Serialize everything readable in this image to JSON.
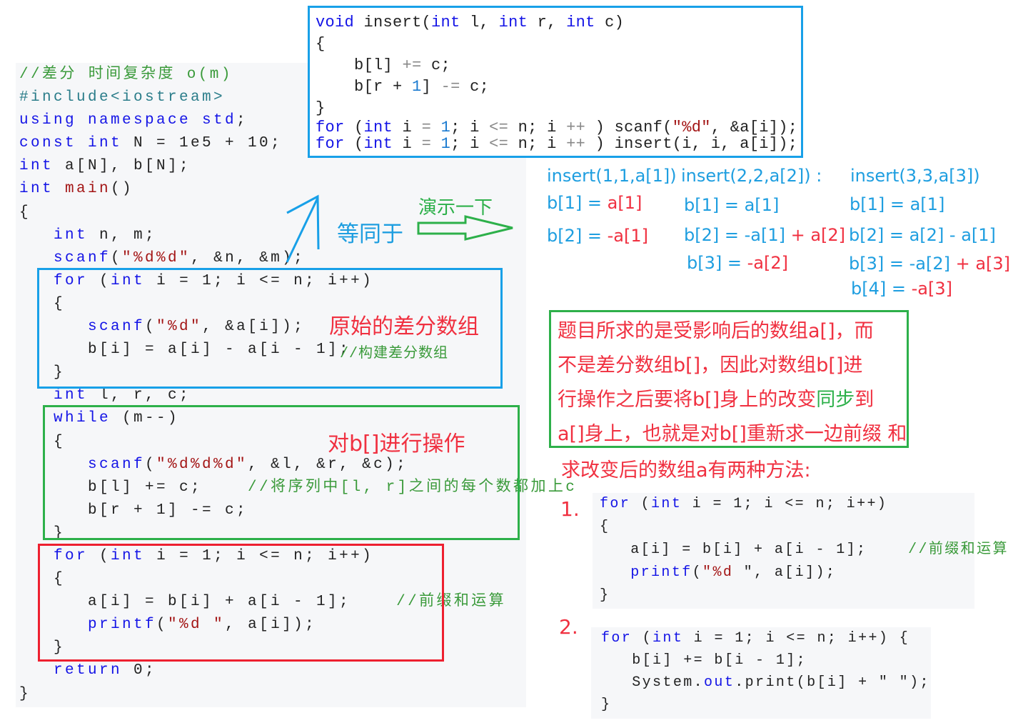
{
  "main_code": {
    "lines": [
      [
        [
          "//差分 时间复杂度 o(m)",
          "cm"
        ]
      ],
      [
        [
          "#include<iostream>",
          "pp"
        ]
      ],
      [
        [
          "using namespace std",
          "k"
        ],
        [
          ";",
          ""
        ]
      ],
      [
        [
          "const int",
          "k"
        ],
        [
          " N = 1e5 + 10;",
          ""
        ]
      ],
      [
        [
          "int",
          "k"
        ],
        [
          " a[N], b[N];",
          ""
        ]
      ],
      [
        [
          "int",
          "k"
        ],
        [
          " ",
          ""
        ],
        [
          "main",
          "f"
        ],
        [
          "()",
          ""
        ]
      ],
      [
        [
          "{",
          ""
        ]
      ],
      [
        [
          "   ",
          ""
        ],
        [
          "int",
          "k"
        ],
        [
          " n, m;",
          ""
        ]
      ],
      [
        [
          "   ",
          ""
        ],
        [
          "scanf",
          "fn"
        ],
        [
          "(",
          ""
        ],
        [
          "\"%d%d\"",
          "s"
        ],
        [
          ", &n, &m);",
          ""
        ]
      ],
      [
        [
          "   ",
          ""
        ],
        [
          "for",
          "k"
        ],
        [
          " (",
          ""
        ],
        [
          "int",
          "k"
        ],
        [
          " i = 1; i <= n; i++)",
          ""
        ]
      ],
      [
        [
          "   {",
          ""
        ]
      ],
      [
        [
          "      ",
          ""
        ],
        [
          "scanf",
          "fn"
        ],
        [
          "(",
          ""
        ],
        [
          "\"%d\"",
          "s"
        ],
        [
          ", &a[i]);",
          ""
        ]
      ],
      [
        [
          "      b[i] = a[i] - a[i - 1];",
          ""
        ]
      ],
      [
        [
          "   }",
          ""
        ]
      ],
      [
        [
          "   ",
          ""
        ],
        [
          "int",
          "k"
        ],
        [
          " l, r, c;",
          ""
        ]
      ],
      [
        [
          "   ",
          ""
        ],
        [
          "while",
          "k"
        ],
        [
          " (m--)",
          ""
        ]
      ],
      [
        [
          "   {",
          ""
        ]
      ],
      [
        [
          "      ",
          ""
        ],
        [
          "scanf",
          "fn"
        ],
        [
          "(",
          ""
        ],
        [
          "\"%d%d%d\"",
          "s"
        ],
        [
          ", &l, &r, &c);",
          ""
        ]
      ],
      [
        [
          "      b[l] += c;    ",
          ""
        ],
        [
          "//将序列中[l, r]之间的每个数都加上c",
          "cm"
        ]
      ],
      [
        [
          "      b[r + 1] -= c;",
          ""
        ]
      ],
      [
        [
          "   }",
          ""
        ]
      ],
      [
        [
          "   ",
          ""
        ],
        [
          "for",
          "k"
        ],
        [
          " (",
          ""
        ],
        [
          "int",
          "k"
        ],
        [
          " i = 1; i <= n; i++)",
          ""
        ]
      ],
      [
        [
          "   {",
          ""
        ]
      ],
      [
        [
          "      a[i] = b[i] + a[i - 1];    ",
          ""
        ],
        [
          "//前缀和运算",
          "cm"
        ]
      ],
      [
        [
          "      ",
          ""
        ],
        [
          "printf",
          "fn"
        ],
        [
          "(",
          ""
        ],
        [
          "\"%d \"",
          "s"
        ],
        [
          ", a[i]);",
          ""
        ]
      ],
      [
        [
          "   }",
          ""
        ]
      ],
      [
        [
          "   ",
          ""
        ],
        [
          "return",
          "k"
        ],
        [
          " 0;",
          ""
        ]
      ],
      [
        [
          "}",
          ""
        ]
      ]
    ]
  },
  "insert_code": {
    "lines": [
      [
        [
          "void",
          "k"
        ],
        [
          " insert(",
          ""
        ],
        [
          "int",
          "k"
        ],
        [
          " l, ",
          ""
        ],
        [
          "int",
          "k"
        ],
        [
          " r, ",
          ""
        ],
        [
          "int",
          "k"
        ],
        [
          " c)",
          ""
        ]
      ],
      [
        [
          "{",
          ""
        ]
      ],
      [
        [
          "    b[l] ",
          ""
        ],
        [
          "+=",
          "op"
        ],
        [
          " c;",
          ""
        ]
      ],
      [
        [
          "    b[r + ",
          ""
        ],
        [
          "1",
          "nm"
        ],
        [
          "] ",
          ""
        ],
        [
          "-=",
          "op"
        ],
        [
          " c;",
          ""
        ]
      ],
      [
        [
          "}",
          ""
        ]
      ],
      [
        [
          "for",
          "k"
        ],
        [
          " (",
          ""
        ],
        [
          "int",
          "k"
        ],
        [
          " i ",
          ""
        ],
        [
          "=",
          "op"
        ],
        [
          " ",
          ""
        ],
        [
          "1",
          "nm"
        ],
        [
          "; i ",
          ""
        ],
        [
          "<=",
          "op"
        ],
        [
          " n; i ",
          ""
        ],
        [
          "++",
          "op"
        ],
        [
          " ) scanf(",
          ""
        ],
        [
          "\"%d\"",
          "s"
        ],
        [
          ", &a[i]);",
          ""
        ]
      ],
      [
        [
          "for",
          "k"
        ],
        [
          " (",
          ""
        ],
        [
          "int",
          "k"
        ],
        [
          " i ",
          ""
        ],
        [
          "=",
          "op"
        ],
        [
          " ",
          ""
        ],
        [
          "1",
          "nm"
        ],
        [
          "; i ",
          ""
        ],
        [
          "<=",
          "op"
        ],
        [
          " n; i ",
          ""
        ],
        [
          "++",
          "op"
        ],
        [
          " ) insert(i, i, a[i]);",
          ""
        ]
      ]
    ]
  },
  "annotations": {
    "equivalent": "等同于",
    "demo": "演示一下",
    "original_diff": "原始的差分数组",
    "build_comment": "//构建差分数组",
    "operate_b": "对b[]进行操作"
  },
  "calc": {
    "col1": {
      "title": "insert(1,1,a[1])",
      "l1a": "b[1] = ",
      "l1b": "a[1]",
      "l2a": "b[2] = ",
      "l2b": "-a[1]"
    },
    "col2": {
      "title": "insert(2,2,a[2]) :",
      "l1": "b[1] = a[1]",
      "l2a": "b[2] = -a[1] ",
      "l2b": "+ a[2]",
      "l3a": "b[3] = ",
      "l3b": "-a[2]"
    },
    "col3": {
      "title": "insert(3,3,a[3])",
      "l1": "b[1] = a[1]",
      "l2": "b[2] = a[2] - a[1]",
      "l3a": "b[3] = -a[2] ",
      "l3b": "+ a[3]",
      "l4a": "b[4] = ",
      "l4b": "-a[3]"
    }
  },
  "explanation": {
    "line1": "题目所求的是受影响后的数组a[]，而",
    "line2": "不是差分数组b[]，因此对数组b[]进",
    "line3a": "行操作之后要将b[]身上的改变",
    "line3b": "同步",
    "line3c": "到",
    "line4": "a[]身上，也就是对b[]重新求一边前缀 和",
    "methods": "求改变后的数组a有两种方法:"
  },
  "method1": {
    "label": "1.",
    "lines": [
      [
        [
          "for",
          "k"
        ],
        [
          " (",
          ""
        ],
        [
          "int",
          "k"
        ],
        [
          " i = 1; i <= n; i++)",
          ""
        ]
      ],
      [
        [
          "{",
          ""
        ]
      ],
      [
        [
          "   a[i] = b[i] + a[i - 1];    ",
          ""
        ],
        [
          "//前缀和运算",
          "cm"
        ]
      ],
      [
        [
          "   ",
          ""
        ],
        [
          "printf",
          "fn"
        ],
        [
          "(",
          ""
        ],
        [
          "\"%d",
          "s"
        ],
        [
          " \", a[i]);",
          ""
        ]
      ],
      [
        [
          "}",
          ""
        ]
      ]
    ]
  },
  "method2": {
    "label": "2.",
    "lines": [
      [
        [
          "for",
          "k"
        ],
        [
          " (",
          ""
        ],
        [
          "int",
          "k"
        ],
        [
          " i = 1; i <= n; i++) {",
          ""
        ]
      ],
      [
        [
          "   b[i] += b[i - 1];",
          ""
        ]
      ],
      [
        [
          "   System.",
          ""
        ],
        [
          "out",
          "k"
        ],
        [
          ".print(b[i] + \" \");",
          ""
        ]
      ],
      [
        [
          "}",
          ""
        ]
      ]
    ]
  },
  "colors": {
    "blue_box": "#18a0e8",
    "green_box": "#2db04a",
    "red_box": "#ee2030",
    "annotation_red": "#f03040",
    "annotation_blue": "#1e9ee0"
  }
}
